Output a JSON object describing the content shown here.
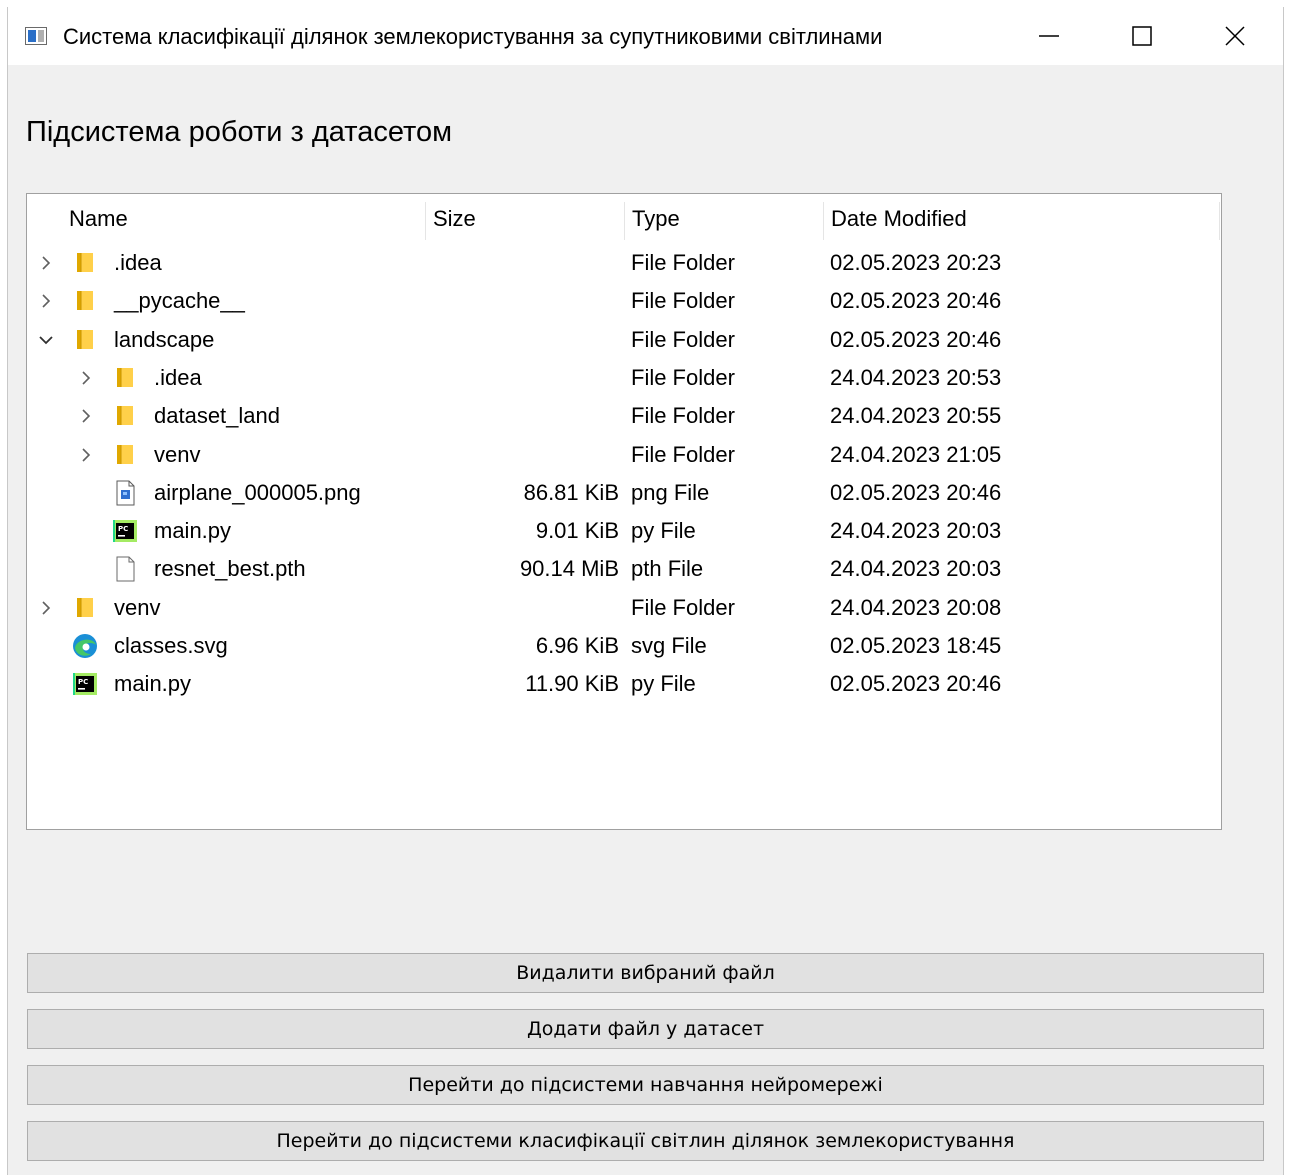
{
  "window": {
    "title": "Система класифікації ділянок землекористування за супутниковими світлинами",
    "min_icon": "minimize-icon",
    "max_icon": "maximize-icon",
    "close_icon": "close-icon"
  },
  "heading": "Підсистема роботи з датасетом",
  "file_tree": {
    "columns": [
      "Name",
      "Size",
      "Type",
      "Date Modified"
    ],
    "rows": [
      {
        "name": ".idea",
        "size": "",
        "type": "File Folder",
        "date": "02.05.2023 20:23",
        "level": 0,
        "expander": "collapsed",
        "icon": "folder-icon"
      },
      {
        "name": "__pycache__",
        "size": "",
        "type": "File Folder",
        "date": "02.05.2023 20:46",
        "level": 0,
        "expander": "collapsed",
        "icon": "folder-icon"
      },
      {
        "name": "landscape",
        "size": "",
        "type": "File Folder",
        "date": "02.05.2023 20:46",
        "level": 0,
        "expander": "expanded",
        "icon": "folder-icon"
      },
      {
        "name": ".idea",
        "size": "",
        "type": "File Folder",
        "date": "24.04.2023 20:53",
        "level": 1,
        "expander": "collapsed",
        "icon": "folder-icon"
      },
      {
        "name": "dataset_land",
        "size": "",
        "type": "File Folder",
        "date": "24.04.2023 20:55",
        "level": 1,
        "expander": "collapsed",
        "icon": "folder-icon"
      },
      {
        "name": "venv",
        "size": "",
        "type": "File Folder",
        "date": "24.04.2023 21:05",
        "level": 1,
        "expander": "collapsed",
        "icon": "folder-icon"
      },
      {
        "name": "airplane_000005.png",
        "size": "86.81 KiB",
        "type": "png File",
        "date": "02.05.2023 20:46",
        "level": 1,
        "expander": "none",
        "icon": "image-file-icon"
      },
      {
        "name": "main.py",
        "size": "9.01 KiB",
        "type": "py File",
        "date": "24.04.2023 20:03",
        "level": 1,
        "expander": "none",
        "icon": "pycharm-file-icon"
      },
      {
        "name": "resnet_best.pth",
        "size": "90.14 MiB",
        "type": "pth File",
        "date": "24.04.2023 20:03",
        "level": 1,
        "expander": "none",
        "icon": "blank-file-icon"
      },
      {
        "name": "venv",
        "size": "",
        "type": "File Folder",
        "date": "24.04.2023 20:08",
        "level": 0,
        "expander": "collapsed",
        "icon": "folder-icon"
      },
      {
        "name": "classes.svg",
        "size": "6.96 KiB",
        "type": "svg File",
        "date": "02.05.2023 18:45",
        "level": 0,
        "expander": "none",
        "icon": "edge-browser-icon"
      },
      {
        "name": "main.py",
        "size": "11.90 KiB",
        "type": "py File",
        "date": "02.05.2023 20:46",
        "level": 0,
        "expander": "none",
        "icon": "pycharm-file-icon"
      }
    ]
  },
  "buttons": {
    "delete": "Видалити вибраний файл",
    "add": "Додати файл у датасет",
    "goto_training": "Перейти до підсистеми навчання нейромережі",
    "goto_classification": "Перейти до підсистеми класифікації світлин ділянок землекористування"
  }
}
